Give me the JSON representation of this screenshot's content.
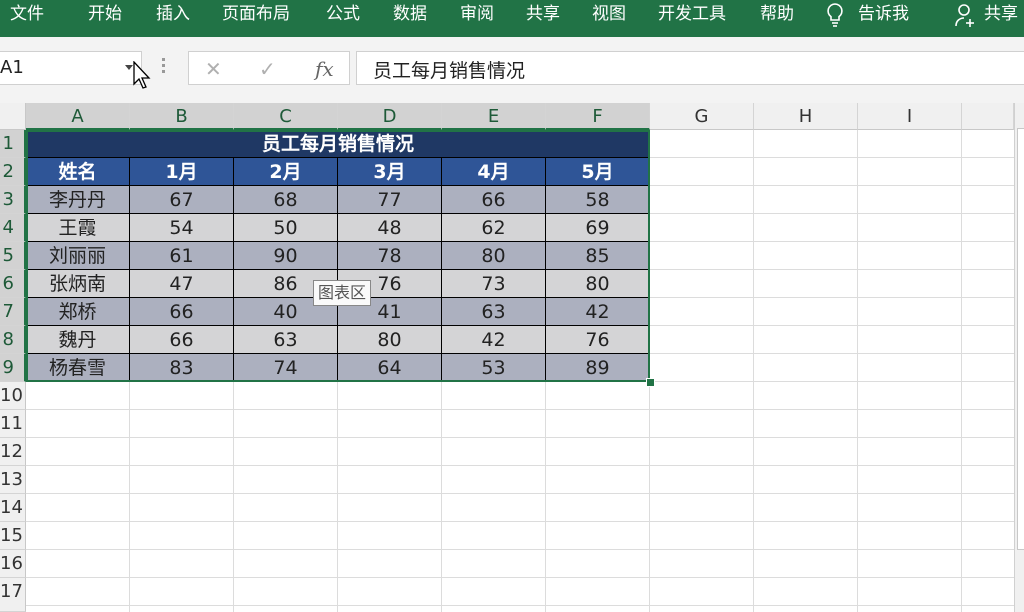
{
  "ribbon": {
    "tabs": [
      "文件",
      "开始",
      "插入",
      "页面布局",
      "公式",
      "数据",
      "审阅",
      "共享",
      "视图",
      "开发工具",
      "帮助"
    ],
    "tell_me": "告诉我",
    "share": "共享"
  },
  "formula_bar": {
    "name_box": "A1",
    "cancel": "✕",
    "enter": "✓",
    "fx": "fx",
    "content": "员工每月销售情况"
  },
  "columns": [
    "A",
    "B",
    "C",
    "D",
    "E",
    "F",
    "G",
    "H",
    "I"
  ],
  "rows": [
    "1",
    "2",
    "3",
    "4",
    "5",
    "6",
    "7",
    "8",
    "9",
    "10",
    "11",
    "12",
    "13",
    "14",
    "15",
    "16",
    "17"
  ],
  "table": {
    "title": "员工每月销售情况",
    "headers": [
      "姓名",
      "1月",
      "2月",
      "3月",
      "4月",
      "5月"
    ],
    "rows": [
      [
        "李丹丹",
        "67",
        "68",
        "77",
        "66",
        "58"
      ],
      [
        "王霞",
        "54",
        "50",
        "48",
        "62",
        "69"
      ],
      [
        "刘丽丽",
        "61",
        "90",
        "78",
        "80",
        "85"
      ],
      [
        "张炳南",
        "47",
        "86",
        "76",
        "73",
        "80"
      ],
      [
        "郑桥",
        "66",
        "40",
        "41",
        "63",
        "42"
      ],
      [
        "魏丹",
        "66",
        "63",
        "80",
        "42",
        "76"
      ],
      [
        "杨春雪",
        "83",
        "74",
        "64",
        "53",
        "89"
      ]
    ]
  },
  "tooltip": "图表区",
  "colors": {
    "ribbon": "#217346",
    "title_bg": "#1f3864",
    "header_bg": "#2f5597",
    "row_dark": "#acb0bf",
    "row_light": "#d4d4d6"
  }
}
